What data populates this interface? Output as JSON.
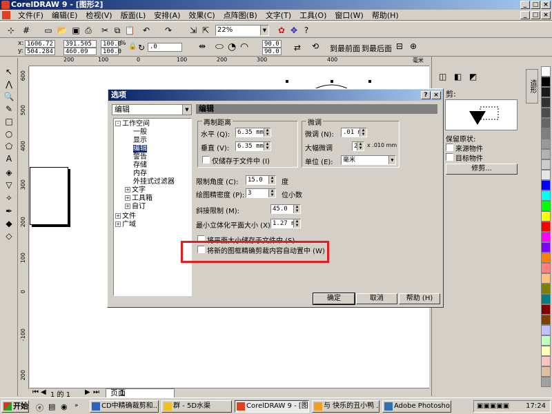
{
  "window": {
    "title": "CorelDRAW 9 - [图形2]"
  },
  "menu": {
    "items": [
      "文件(F)",
      "编辑(E)",
      "检视(V)",
      "版面(L)",
      "安排(A)",
      "效果(C)",
      "点阵图(B)",
      "文字(T)",
      "工具(O)",
      "窗口(W)",
      "帮助(H)"
    ]
  },
  "toolbar": {
    "zoom": "22%"
  },
  "propbar": {
    "x": "1606.72",
    "y": "504.284",
    "w": "391.505 mm",
    "h": "460.09 mm",
    "sx": "100.0",
    "sy": "100.0",
    "pct": "%",
    "rot": ".0",
    "a1": "90.0",
    "a2": "90.0",
    "front": "到最前面",
    "back": "到最后面"
  },
  "rulers": {
    "h": [
      "200",
      "100",
      "0",
      "100",
      "200",
      "300",
      "400",
      "毫米"
    ],
    "v": [
      "600",
      "500",
      "400",
      "300",
      "200",
      "100",
      "0",
      "-100",
      "200"
    ]
  },
  "pagenav": {
    "count": "1 的 1",
    "tab_label": "页面",
    "tab_num": "1"
  },
  "docker": {
    "title": "剪:",
    "keep": "保留原状:",
    "opt1": "来源物件",
    "opt2": "目标物件",
    "apply": "修剪...",
    "tab": "造形"
  },
  "dialog": {
    "title": "选项",
    "category": "编辑",
    "tree": [
      "工作空间",
      "一般",
      "显示",
      "编辑",
      "警告",
      "存储",
      "内存",
      "外挂式过滤器",
      "文字",
      "工具箱",
      "自订",
      "文件",
      "广域"
    ],
    "header": "编辑",
    "dup": {
      "title": "再制距离",
      "h_label": "水平 (Q):",
      "h_val": "6.35 mm",
      "v_label": "垂直 (V):",
      "v_val": "6.35 mm",
      "save": "仅储存于文件中 (I)"
    },
    "nudge": {
      "title": "微调",
      "n_label": "微调 (N):",
      "n_val": ".01 mm",
      "big_label": "大幅微调",
      "big_val": "2",
      "big_suffix": "x .010 mm",
      "unit_label": "单位 (E):",
      "unit_val": "毫米"
    },
    "angle": {
      "label": "限制角度 (C):",
      "val": "15.0",
      "unit": "度"
    },
    "precision": {
      "label": "绘图精密度 (P):",
      "val": "3",
      "unit": "位小数"
    },
    "miter": {
      "label": "斜接限制 (M):",
      "val": "45.0"
    },
    "minext": {
      "label": "最小立体化平面大小 (X):",
      "val": "1.27 mm"
    },
    "opt_save_page": "将平面大小储存于文件中 (S)",
    "opt_auto_center": "将新的图框精确剪裁内容自动置中 (W)",
    "ok": "确定",
    "cancel": "取消",
    "help": "帮助 (H)"
  },
  "taskbar": {
    "start": "开始",
    "tasks": [
      "CD中精确裁剪和...",
      "群 - 5D水渠",
      "CorelDRAW 9 - [图...",
      "与 快乐的丑小鸭 ...",
      "Adobe Photoshop"
    ],
    "clock": "17:24"
  },
  "palette": [
    "#ffffff",
    "#000000",
    "#1a1a1a",
    "#333333",
    "#4d4d4d",
    "#666666",
    "#808080",
    "#999999",
    "#b3b3b3",
    "#cccccc",
    "#e6e6e6",
    "#0000ff",
    "#00ffff",
    "#00ff00",
    "#ffff00",
    "#ff0000",
    "#ff00ff",
    "#8000ff",
    "#ff8000",
    "#ff8080",
    "#ffc080",
    "#808000",
    "#008080",
    "#800000",
    "#804000",
    "#c0c0ff",
    "#c0ffc0",
    "#ffffc0",
    "#ffc0c0",
    "#e0c0a0",
    "#a0a0a0"
  ]
}
